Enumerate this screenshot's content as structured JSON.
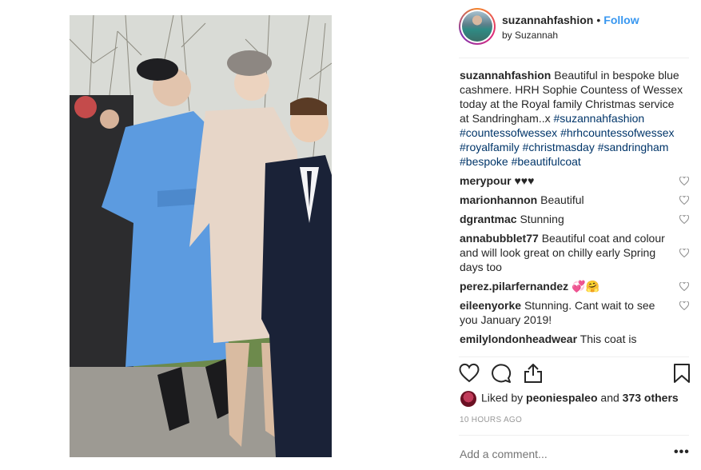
{
  "post": {
    "username": "suzannahfashion",
    "separator": "•",
    "follow_label": "Follow",
    "subtitle": "by Suzannah"
  },
  "caption": {
    "username": "suzannahfashion",
    "text": "Beautiful in bespoke blue cashmere. HRH Sophie Countess of Wessex today at the Royal family Christmas service at Sandringham..x",
    "hashtags": "#suzannahfashion #countessofwessex #hrhcountessofwessex #royalfamily #christmasday #sandringham #bespoke #beautifulcoat"
  },
  "comments": [
    {
      "username": "merypour",
      "text": "♥♥♥"
    },
    {
      "username": "marionhannon",
      "text": "Beautiful"
    },
    {
      "username": "dgrantmac",
      "text": "Stunning"
    },
    {
      "username": "annabubblet77",
      "text": "Beautiful coat and colour and will look great on chilly early Spring days too"
    },
    {
      "username": "perez.pilarfernandez",
      "text": "💞🤗"
    },
    {
      "username": "eileenyorke",
      "text": "Stunning. Cant wait to see you January 2019!"
    },
    {
      "username": "emilylondonheadwear",
      "text": "This coat is"
    }
  ],
  "likes": {
    "prefix": "Liked by",
    "user": "peoniespaleo",
    "and": "and",
    "others": "373 others"
  },
  "time_ago": "10 HOURS AGO",
  "add_comment_placeholder": "Add a comment...",
  "more_label": "•••",
  "icons": {
    "like": "heart-icon",
    "comment": "comment-icon",
    "share": "share-icon",
    "save": "bookmark-icon"
  },
  "colors": {
    "link_blue": "#3897f0",
    "hashtag": "#003569",
    "coat_blue": "#5c9be0"
  }
}
